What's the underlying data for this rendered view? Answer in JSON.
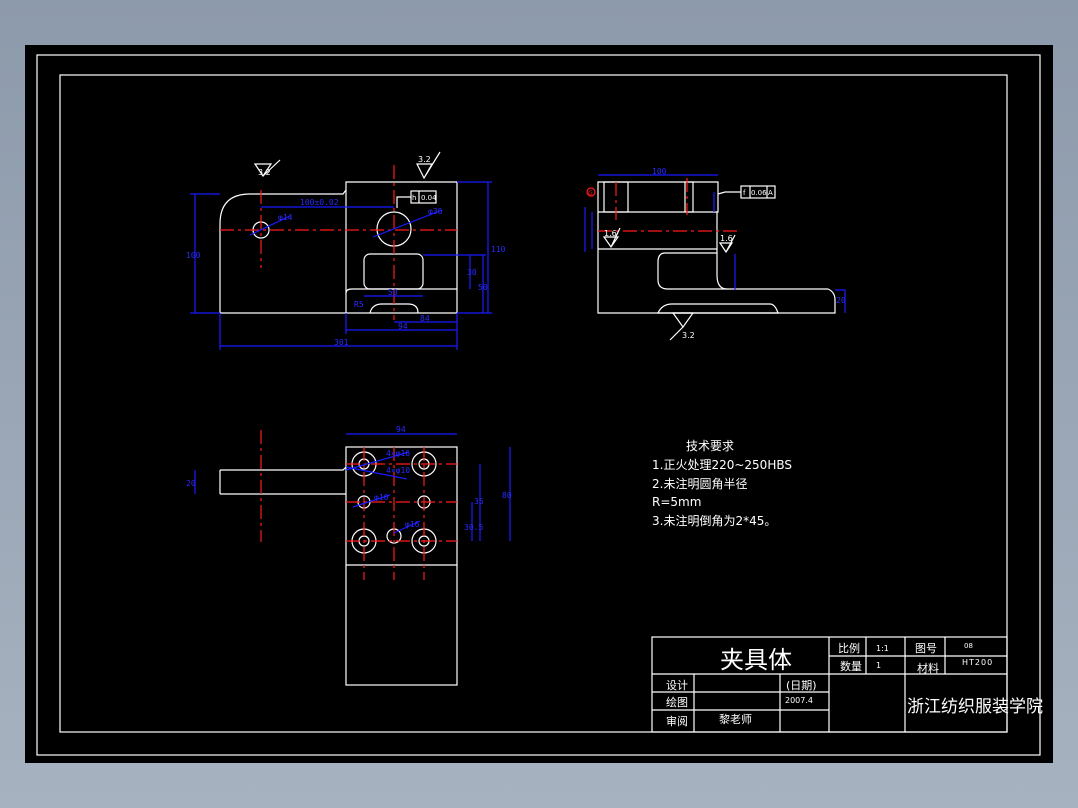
{
  "drawing": {
    "colors": {
      "background": "#000000",
      "outline": "#ffffff",
      "dimension": "#1a1aff",
      "centerline": "#ff1a1a",
      "app_background": "#8d9aab"
    },
    "front_view": {
      "roughness": [
        "3.2",
        "3.2"
      ],
      "tolerance_frame": [
        "h",
        "0.04"
      ],
      "dims": [
        "100±0.02",
        "φ14",
        "φ30",
        "100",
        "110",
        "30",
        "50",
        "50",
        "84",
        "94",
        "301",
        "R5"
      ]
    },
    "section_view": {
      "roughness": [
        "1.6",
        "1.6",
        "3.2"
      ],
      "tolerance_frame": [
        "f",
        "0.06",
        "A"
      ],
      "datum": "G",
      "dims": [
        "100",
        "20"
      ]
    },
    "top_view": {
      "dims": [
        "94",
        "4×φ16",
        "4×φ10",
        "φ10",
        "φ16",
        "20",
        "35",
        "30.5",
        "80"
      ]
    }
  },
  "tech_requirements": {
    "title": "技术要求",
    "items": [
      "1.正火处理220~250HBS",
      "2.未注明圆角半径",
      "R=5mm",
      "3.未注明倒角为2*45。"
    ]
  },
  "title_block": {
    "part_name": "夹具体",
    "scale_label": "比例",
    "scale_value": "1:1",
    "drawing_no_label": "图号",
    "drawing_no_value": "08",
    "quantity_label": "数量",
    "quantity_value": "1",
    "material_label": "材料",
    "material_value": "HT200",
    "design_label": "设计",
    "draw_label": "绘图",
    "review_label": "审阅",
    "date_label": "(日期)",
    "date_value": "2007.4",
    "reviewer": "黎老师",
    "school": "浙江纺织服装学院"
  }
}
